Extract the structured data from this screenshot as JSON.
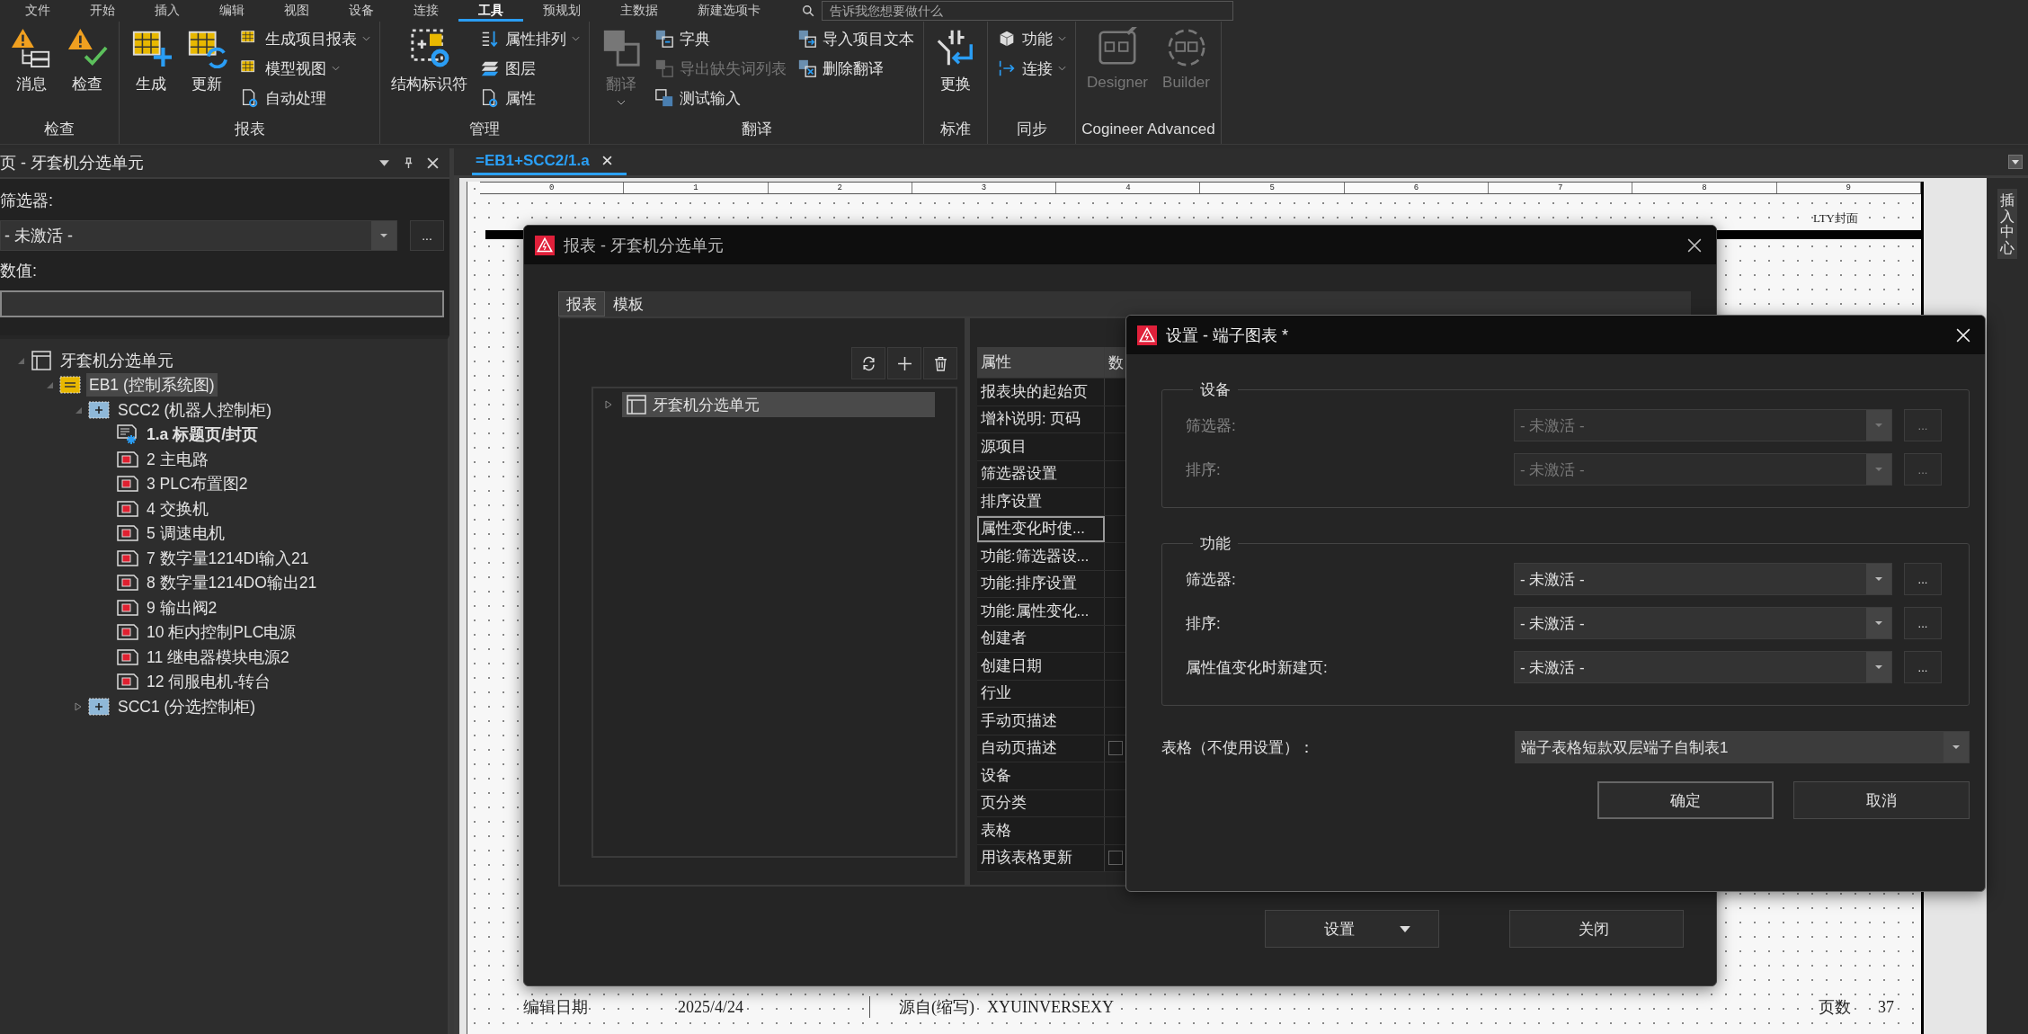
{
  "menu": [
    {
      "label": "文件",
      "selected": false
    },
    {
      "label": "开始",
      "selected": false
    },
    {
      "label": "插入",
      "selected": false
    },
    {
      "label": "编辑",
      "selected": false
    },
    {
      "label": "视图",
      "selected": false
    },
    {
      "label": "设备",
      "selected": false
    },
    {
      "label": "连接",
      "selected": false
    },
    {
      "label": "工具",
      "selected": true
    },
    {
      "label": "预规划",
      "selected": false
    },
    {
      "label": "主数据",
      "selected": false
    },
    {
      "label": "新建选项卡",
      "selected": false
    }
  ],
  "search": {
    "placeholder": "告诉我您想要做什么"
  },
  "ribbon": [
    {
      "label": "检查",
      "items": [
        {
          "kind": "large",
          "label": "消息",
          "disabled": false,
          "dropdown": false
        },
        {
          "kind": "large",
          "label": "检查",
          "disabled": false,
          "dropdown": false
        }
      ]
    },
    {
      "label": "报表",
      "items": [
        {
          "kind": "large",
          "label": "生成",
          "disabled": false,
          "dropdown": false
        },
        {
          "kind": "large",
          "label": "更新",
          "disabled": false,
          "dropdown": false
        },
        {
          "kind": "small",
          "label": "生成项目报表",
          "disabled": false,
          "dropdown": true
        },
        {
          "kind": "small",
          "label": "模型视图",
          "disabled": false,
          "dropdown": true
        },
        {
          "kind": "small",
          "label": "自动处理",
          "disabled": false,
          "dropdown": false
        }
      ]
    },
    {
      "label": "管理",
      "items": [
        {
          "kind": "large",
          "label": "结构标识符",
          "disabled": false,
          "dropdown": false
        },
        {
          "kind": "small",
          "label": "属性排列",
          "disabled": false,
          "dropdown": true
        },
        {
          "kind": "small",
          "label": "图层",
          "disabled": false,
          "dropdown": false
        },
        {
          "kind": "small",
          "label": "属性",
          "disabled": false,
          "dropdown": false
        }
      ]
    },
    {
      "label": "翻译",
      "items": [
        {
          "kind": "large",
          "label": "翻译",
          "disabled": true,
          "dropdown": true
        },
        {
          "kind": "small",
          "label": "字典",
          "disabled": false,
          "dropdown": false
        },
        {
          "kind": "small",
          "label": "导出缺失词列表",
          "disabled": true,
          "dropdown": false
        },
        {
          "kind": "small",
          "label": "测试输入",
          "disabled": false,
          "dropdown": false
        },
        {
          "kind": "small",
          "label": "导入项目文本",
          "disabled": false,
          "dropdown": false
        },
        {
          "kind": "small",
          "label": "删除翻译",
          "disabled": false,
          "dropdown": false
        }
      ]
    },
    {
      "label": "标准",
      "items": [
        {
          "kind": "large",
          "label": "更换",
          "disabled": false,
          "dropdown": false
        }
      ]
    },
    {
      "label": "同步",
      "items": [
        {
          "kind": "small",
          "label": "功能",
          "disabled": false,
          "dropdown": true
        },
        {
          "kind": "small",
          "label": "连接",
          "disabled": false,
          "dropdown": true
        }
      ]
    },
    {
      "label": "Cogineer Advanced",
      "items": [
        {
          "kind": "large",
          "label": "Designer",
          "disabled": true,
          "dropdown": false
        },
        {
          "kind": "large",
          "label": "Builder",
          "disabled": true,
          "dropdown": false
        }
      ]
    }
  ],
  "pages_panel": {
    "title": "页 - 牙套机分选单元",
    "filter_label": "筛选器:",
    "filter_value": "- 未激活 -",
    "more_button": "...",
    "value_label": "数值:",
    "tree": [
      {
        "kind": "project",
        "label": "牙套机分选单元",
        "selected": false,
        "expanded": true,
        "children": [
          {
            "kind": "function",
            "label": "EB1 (控制系统图)",
            "selected": true,
            "expanded": true,
            "children": [
              {
                "kind": "location",
                "label": "SCC2 (机器人控制柜)",
                "selected": false,
                "expanded": true,
                "children": [
                  {
                    "kind": "cover",
                    "label": "1.a 标题页/封页",
                    "selected": false,
                    "open": true
                  },
                  {
                    "kind": "page",
                    "label": "2 主电路",
                    "selected": false,
                    "open": false
                  },
                  {
                    "kind": "page",
                    "label": "3 PLC布置图2",
                    "selected": false,
                    "open": false
                  },
                  {
                    "kind": "page",
                    "label": "4 交换机",
                    "selected": false,
                    "open": false
                  },
                  {
                    "kind": "page",
                    "label": "5 调速电机",
                    "selected": false,
                    "open": false
                  },
                  {
                    "kind": "page",
                    "label": "7 数字量1214DI输入21",
                    "selected": false,
                    "open": false
                  },
                  {
                    "kind": "page",
                    "label": "8 数字量1214DO输出21",
                    "selected": false,
                    "open": false
                  },
                  {
                    "kind": "page",
                    "label": "9 输出阀2",
                    "selected": false,
                    "open": false
                  },
                  {
                    "kind": "page",
                    "label": "10 柜内控制PLC电源",
                    "selected": false,
                    "open": false
                  },
                  {
                    "kind": "page",
                    "label": "11 继电器模块电源2",
                    "selected": false,
                    "open": false
                  },
                  {
                    "kind": "page",
                    "label": "12 伺服电机-转台",
                    "selected": false,
                    "open": false
                  }
                ]
              },
              {
                "kind": "location",
                "label": "SCC1 (分选控制柜)",
                "selected": false,
                "expanded": false
              }
            ]
          }
        ]
      }
    ]
  },
  "doc_tabs": [
    {
      "label": "=EB1+SCC2/1.a",
      "selected": true
    }
  ],
  "sheet": {
    "columns": [
      "0",
      "1",
      "2",
      "3",
      "4",
      "5",
      "6",
      "7",
      "8",
      "9"
    ],
    "title": "LTY封面",
    "footer": [
      {
        "label": "编辑日期",
        "value": "2025/4/24"
      },
      {
        "label": "源自(缩写)",
        "value": "XYUINVERSEXY"
      },
      {
        "label": "页数",
        "value": "37"
      }
    ]
  },
  "side_panel": {
    "label": "插入中心"
  },
  "report_dialog": {
    "title": "报表 - 牙套机分选单元",
    "tabs": [
      {
        "label": "报表",
        "selected": true
      },
      {
        "label": "模板",
        "selected": false
      }
    ],
    "tree": [
      {
        "label": "牙套机分选单元",
        "selected": true,
        "expanded": false
      }
    ],
    "property_header": "属性",
    "value_header": "数",
    "properties": [
      {
        "kind": "text",
        "label": "报表块的起始页",
        "selected": false
      },
      {
        "kind": "text",
        "label": "增补说明: 页码",
        "selected": false
      },
      {
        "kind": "text",
        "label": "源项目",
        "selected": false
      },
      {
        "kind": "text",
        "label": "筛选器设置",
        "selected": false
      },
      {
        "kind": "text",
        "label": "排序设置",
        "selected": false
      },
      {
        "kind": "text",
        "label": "属性变化时使...",
        "selected": true
      },
      {
        "kind": "text",
        "label": "功能:筛选器设...",
        "selected": false
      },
      {
        "kind": "text",
        "label": "功能:排序设置",
        "selected": false
      },
      {
        "kind": "text",
        "label": "功能:属性变化...",
        "selected": false
      },
      {
        "kind": "text",
        "label": "创建者",
        "selected": false
      },
      {
        "kind": "text",
        "label": "创建日期",
        "selected": false
      },
      {
        "kind": "text",
        "label": "行业",
        "selected": false
      },
      {
        "kind": "text",
        "label": "手动页描述",
        "selected": false
      },
      {
        "kind": "checkbox",
        "label": "自动页描述",
        "selected": false,
        "checked": false
      },
      {
        "kind": "text",
        "label": "设备",
        "selected": false
      },
      {
        "kind": "text",
        "label": "页分类",
        "selected": false
      },
      {
        "kind": "text",
        "label": "表格",
        "selected": false
      },
      {
        "kind": "checkbox",
        "label": "用该表格更新",
        "selected": false,
        "checked": false
      }
    ],
    "buttons": [
      {
        "label": "设置",
        "dropdown": true
      },
      {
        "label": "关闭",
        "dropdown": false
      }
    ]
  },
  "settings_dialog": {
    "title": "设置 - 端子图表 *",
    "groups": [
      {
        "label": "设备",
        "disabled": true,
        "rows": [
          {
            "label": "筛选器:",
            "value": "- 未激活 -",
            "button": "..."
          },
          {
            "label": "排序:",
            "value": "- 未激活 -",
            "button": "..."
          }
        ]
      },
      {
        "label": "功能",
        "disabled": false,
        "rows": [
          {
            "label": "筛选器:",
            "value": "- 未激活 -",
            "button": "..."
          },
          {
            "label": "排序:",
            "value": "- 未激活 -",
            "button": "..."
          },
          {
            "label": "属性值变化时新建页:",
            "value": "- 未激活 -",
            "button": "..."
          }
        ]
      }
    ],
    "form_label": "表格（不使用设置）：",
    "form_value": "端子表格短款双层端子自制表1",
    "buttons": [
      {
        "label": "确定",
        "kind": "default"
      },
      {
        "label": "取消",
        "kind": "normal"
      }
    ]
  }
}
